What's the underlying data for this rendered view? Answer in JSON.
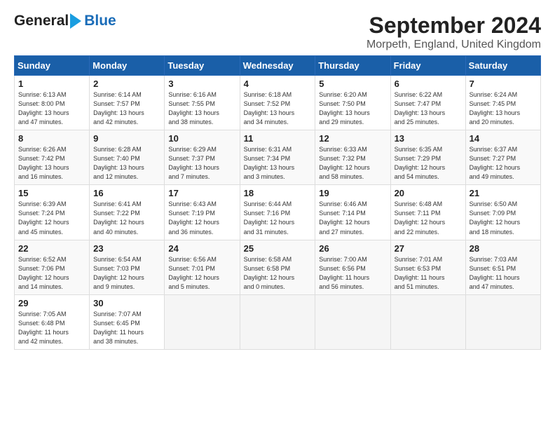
{
  "logo": {
    "general": "General",
    "blue": "Blue"
  },
  "title": "September 2024",
  "subtitle": "Morpeth, England, United Kingdom",
  "days_header": [
    "Sunday",
    "Monday",
    "Tuesday",
    "Wednesday",
    "Thursday",
    "Friday",
    "Saturday"
  ],
  "weeks": [
    [
      {
        "day": "1",
        "info": "Sunrise: 6:13 AM\nSunset: 8:00 PM\nDaylight: 13 hours\nand 47 minutes."
      },
      {
        "day": "2",
        "info": "Sunrise: 6:14 AM\nSunset: 7:57 PM\nDaylight: 13 hours\nand 42 minutes."
      },
      {
        "day": "3",
        "info": "Sunrise: 6:16 AM\nSunset: 7:55 PM\nDaylight: 13 hours\nand 38 minutes."
      },
      {
        "day": "4",
        "info": "Sunrise: 6:18 AM\nSunset: 7:52 PM\nDaylight: 13 hours\nand 34 minutes."
      },
      {
        "day": "5",
        "info": "Sunrise: 6:20 AM\nSunset: 7:50 PM\nDaylight: 13 hours\nand 29 minutes."
      },
      {
        "day": "6",
        "info": "Sunrise: 6:22 AM\nSunset: 7:47 PM\nDaylight: 13 hours\nand 25 minutes."
      },
      {
        "day": "7",
        "info": "Sunrise: 6:24 AM\nSunset: 7:45 PM\nDaylight: 13 hours\nand 20 minutes."
      }
    ],
    [
      {
        "day": "8",
        "info": "Sunrise: 6:26 AM\nSunset: 7:42 PM\nDaylight: 13 hours\nand 16 minutes."
      },
      {
        "day": "9",
        "info": "Sunrise: 6:28 AM\nSunset: 7:40 PM\nDaylight: 13 hours\nand 12 minutes."
      },
      {
        "day": "10",
        "info": "Sunrise: 6:29 AM\nSunset: 7:37 PM\nDaylight: 13 hours\nand 7 minutes."
      },
      {
        "day": "11",
        "info": "Sunrise: 6:31 AM\nSunset: 7:34 PM\nDaylight: 13 hours\nand 3 minutes."
      },
      {
        "day": "12",
        "info": "Sunrise: 6:33 AM\nSunset: 7:32 PM\nDaylight: 12 hours\nand 58 minutes."
      },
      {
        "day": "13",
        "info": "Sunrise: 6:35 AM\nSunset: 7:29 PM\nDaylight: 12 hours\nand 54 minutes."
      },
      {
        "day": "14",
        "info": "Sunrise: 6:37 AM\nSunset: 7:27 PM\nDaylight: 12 hours\nand 49 minutes."
      }
    ],
    [
      {
        "day": "15",
        "info": "Sunrise: 6:39 AM\nSunset: 7:24 PM\nDaylight: 12 hours\nand 45 minutes."
      },
      {
        "day": "16",
        "info": "Sunrise: 6:41 AM\nSunset: 7:22 PM\nDaylight: 12 hours\nand 40 minutes."
      },
      {
        "day": "17",
        "info": "Sunrise: 6:43 AM\nSunset: 7:19 PM\nDaylight: 12 hours\nand 36 minutes."
      },
      {
        "day": "18",
        "info": "Sunrise: 6:44 AM\nSunset: 7:16 PM\nDaylight: 12 hours\nand 31 minutes."
      },
      {
        "day": "19",
        "info": "Sunrise: 6:46 AM\nSunset: 7:14 PM\nDaylight: 12 hours\nand 27 minutes."
      },
      {
        "day": "20",
        "info": "Sunrise: 6:48 AM\nSunset: 7:11 PM\nDaylight: 12 hours\nand 22 minutes."
      },
      {
        "day": "21",
        "info": "Sunrise: 6:50 AM\nSunset: 7:09 PM\nDaylight: 12 hours\nand 18 minutes."
      }
    ],
    [
      {
        "day": "22",
        "info": "Sunrise: 6:52 AM\nSunset: 7:06 PM\nDaylight: 12 hours\nand 14 minutes."
      },
      {
        "day": "23",
        "info": "Sunrise: 6:54 AM\nSunset: 7:03 PM\nDaylight: 12 hours\nand 9 minutes."
      },
      {
        "day": "24",
        "info": "Sunrise: 6:56 AM\nSunset: 7:01 PM\nDaylight: 12 hours\nand 5 minutes."
      },
      {
        "day": "25",
        "info": "Sunrise: 6:58 AM\nSunset: 6:58 PM\nDaylight: 12 hours\nand 0 minutes."
      },
      {
        "day": "26",
        "info": "Sunrise: 7:00 AM\nSunset: 6:56 PM\nDaylight: 11 hours\nand 56 minutes."
      },
      {
        "day": "27",
        "info": "Sunrise: 7:01 AM\nSunset: 6:53 PM\nDaylight: 11 hours\nand 51 minutes."
      },
      {
        "day": "28",
        "info": "Sunrise: 7:03 AM\nSunset: 6:51 PM\nDaylight: 11 hours\nand 47 minutes."
      }
    ],
    [
      {
        "day": "29",
        "info": "Sunrise: 7:05 AM\nSunset: 6:48 PM\nDaylight: 11 hours\nand 42 minutes."
      },
      {
        "day": "30",
        "info": "Sunrise: 7:07 AM\nSunset: 6:45 PM\nDaylight: 11 hours\nand 38 minutes."
      },
      {
        "day": "",
        "info": ""
      },
      {
        "day": "",
        "info": ""
      },
      {
        "day": "",
        "info": ""
      },
      {
        "day": "",
        "info": ""
      },
      {
        "day": "",
        "info": ""
      }
    ]
  ]
}
